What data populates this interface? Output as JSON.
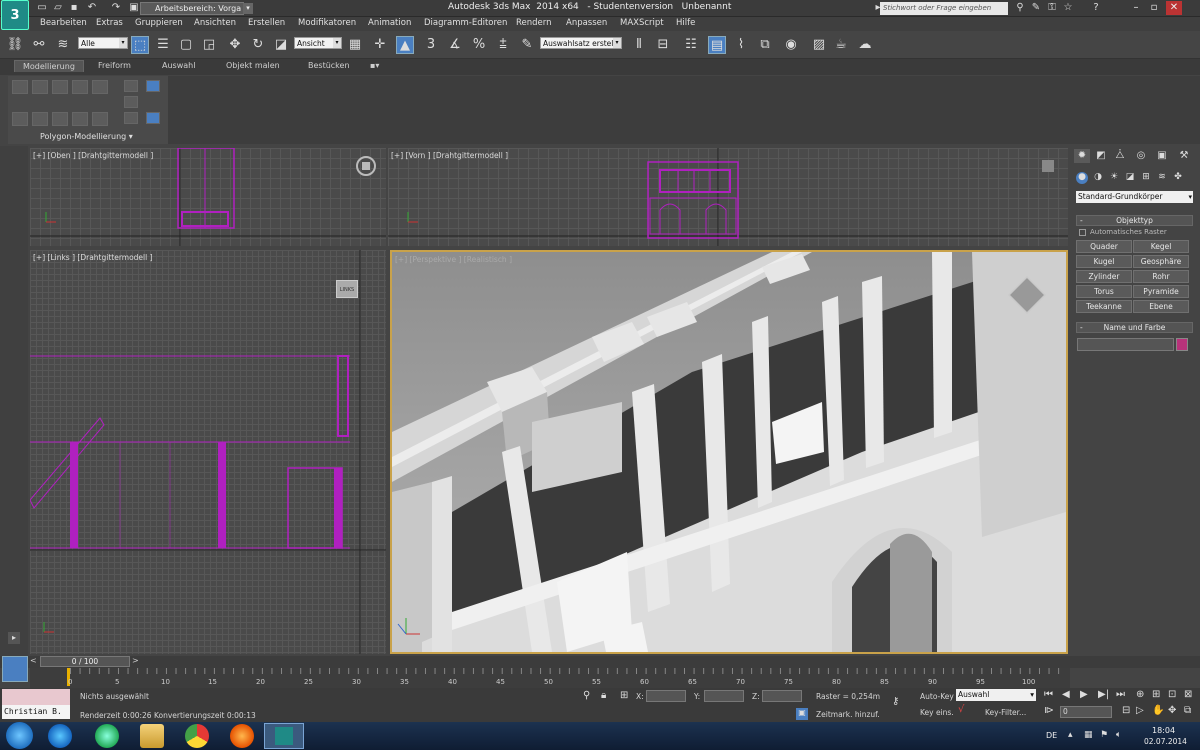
{
  "titlebar": {
    "workspace": "Arbeitsbereich: Vorga",
    "app_title": "Autodesk 3ds Max  2014 x64   - Studentenversion   Unbenannt",
    "search_placeholder": "Stichwort oder Frage eingeben",
    "app_logo": "3"
  },
  "menu": [
    "Bearbeiten",
    "Extras",
    "Gruppieren",
    "Ansichten",
    "Erstellen",
    "Modifikatoren",
    "Animation",
    "Diagramm-Editoren",
    "Rendern",
    "Anpassen",
    "MAXScript",
    "Hilfe"
  ],
  "toolbar": {
    "selection_filter": "Alle",
    "reference_coord": "Ansicht",
    "named_selection": "Auswahlsatz erstell",
    "snap_3": "3",
    "snap_percent": "%"
  },
  "ribbon": {
    "tabs": [
      "Modellierung",
      "Freiform",
      "Auswahl",
      "Objekt malen",
      "Bestücken"
    ],
    "panel_label": "Polygon-Modellierung ▾"
  },
  "viewports": {
    "top": "[+] [Oben ] [Drahtgittermodell ]",
    "front": "[+] [Vorn ] [Drahtgittermodell ]",
    "left": "[+] [Links ] [Drahtgittermodell ]",
    "persp": "[+] [Perspektive ] [Realistisch ]",
    "left_cube": "LINKS"
  },
  "command_panel": {
    "category": "Standard-Grundkörper",
    "objekttyp_title": "Objekttyp",
    "auto_grid": "Automatisches Raster",
    "buttons": [
      "Quader",
      "Kegel",
      "Kugel",
      "Geosphäre",
      "Zylinder",
      "Rohr",
      "Torus",
      "Pyramide",
      "Teekanne",
      "Ebene"
    ],
    "name_color_title": "Name und Farbe",
    "color": "#b8327a"
  },
  "timeline": {
    "slider": "0 / 100",
    "ticks": [
      "0",
      "5",
      "10",
      "15",
      "20",
      "25",
      "30",
      "35",
      "40",
      "45",
      "50",
      "55",
      "60",
      "65",
      "70",
      "75",
      "80",
      "85",
      "90",
      "95",
      "100"
    ]
  },
  "status": {
    "user": "Christian B.",
    "selection": "Nichts ausgewählt",
    "render_time": "Renderzeit  0:00:26     Konvertierungszeit  0:00:13",
    "x_label": "X:",
    "y_label": "Y:",
    "z_label": "Z:",
    "grid": "Raster = 0,254m",
    "timetag": "Zeitmark. hinzuf.",
    "autokey": "Auto-Key",
    "autokey_value": "Auswahl",
    "setkey": "Key eins.",
    "keyfilter": "Key-Filter...",
    "frame": "0"
  },
  "taskbar": {
    "lang": "DE",
    "time": "18:04",
    "date": "02.07.2014"
  }
}
